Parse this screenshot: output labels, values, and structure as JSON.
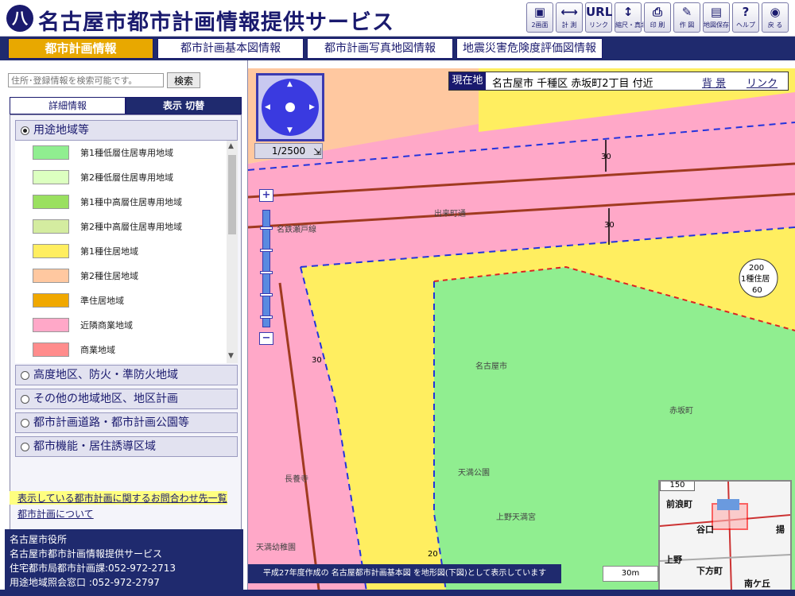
{
  "header": {
    "logo_glyph": "八",
    "title": "名古屋市都市計画情報提供サービス",
    "toolbar": [
      {
        "name": "two-screen-button",
        "icon_name": "two-screen-icon",
        "icon": "▣",
        "label": "2画面"
      },
      {
        "name": "measure-button",
        "icon_name": "ruler-icon",
        "icon": "⟷",
        "label": "計 測"
      },
      {
        "name": "link-button",
        "icon_name": "url-icon",
        "icon": "URL",
        "label": "リンク"
      },
      {
        "name": "zoom-button",
        "icon_name": "zoom-arrows-icon",
        "icon": "↕",
        "label": "縮尺・真北"
      },
      {
        "name": "print-button",
        "icon_name": "printer-icon",
        "icon": "⎙",
        "label": "印 刷"
      },
      {
        "name": "draw-button",
        "icon_name": "pencil-icon",
        "icon": "✎",
        "label": "作 図"
      },
      {
        "name": "save-map-button",
        "icon_name": "floppy-icon",
        "icon": "▤",
        "label": "地図保存"
      },
      {
        "name": "help-button",
        "icon_name": "question-icon",
        "icon": "?",
        "label": "ヘルプ"
      },
      {
        "name": "back-button",
        "icon_name": "back-icon",
        "icon": "◉",
        "label": "戻 る"
      }
    ]
  },
  "tabs": [
    {
      "label": "都市計画情報",
      "active": true
    },
    {
      "label": "都市計画基本図情報",
      "active": false
    },
    {
      "label": "都市計画写真地図情報",
      "active": false
    },
    {
      "label": "地震災害危険度評価図情報",
      "active": false
    }
  ],
  "sidebar": {
    "search_placeholder": "住所･登録情報を検索可能です。",
    "search_button": "検索",
    "mode_tabs": [
      {
        "label": "詳細情報"
      },
      {
        "label": "表示 切替"
      }
    ],
    "layers": [
      {
        "label": "用途地域等",
        "selected": true
      },
      {
        "label": "高度地区、防火・準防火地域",
        "selected": false
      },
      {
        "label": "その他の地域地区、地区計画",
        "selected": false
      },
      {
        "label": "都市計画道路・都市計画公園等",
        "selected": false
      },
      {
        "label": "都市機能・居住誘導区域",
        "selected": false
      }
    ],
    "legend": [
      {
        "label": "第1種低層住居専用地域",
        "color": "#90ee90"
      },
      {
        "label": "第2種低層住居専用地域",
        "color": "#dcffc0"
      },
      {
        "label": "第1種中高層住居専用地域",
        "color": "#9ae060"
      },
      {
        "label": "第2種中高層住居専用地域",
        "color": "#d4eca0"
      },
      {
        "label": "第1種住居地域",
        "color": "#ffee60"
      },
      {
        "label": "第2種住居地域",
        "color": "#ffc8a0"
      },
      {
        "label": "準住居地域",
        "color": "#f0a800"
      },
      {
        "label": "近隣商業地域",
        "color": "#ffa8c8"
      },
      {
        "label": "商業地域",
        "color": "#ff8c8c"
      }
    ],
    "links": [
      "表示している都市計画に関するお問合わせ先一覧",
      "都市計画について"
    ],
    "footer": [
      "名古屋市役所",
      "名古屋市都市計画情報提供サービス",
      "住宅都市局都市計画課:052-972-2713",
      "用途地域照会窓口 :052-972-2797"
    ]
  },
  "map": {
    "scale": "1/2500",
    "location_label": "現在地",
    "location_text": "名古屋市 千種区 赤坂町2丁目 付近",
    "background_link": "背 景",
    "link_link": "リンク",
    "credit": "平成27年度作成の 名古屋都市計画基本図 を地形図(下図)として表示しています",
    "scalebar": "30m",
    "labels": [
      {
        "text": "30",
        "name": "setback-label-30a"
      },
      {
        "text": "30",
        "name": "setback-label-30b"
      },
      {
        "text": "30",
        "name": "setback-label-30c"
      },
      {
        "text": "20",
        "name": "setback-label-20"
      },
      {
        "text": "出来町通",
        "name": "street-label-dekimachi"
      },
      {
        "text": "名鉄瀬戸線",
        "name": "railway-label"
      },
      {
        "text": "名古屋市",
        "name": "place-label-nagoya"
      },
      {
        "text": "赤坂町",
        "name": "place-label-akasaka"
      },
      {
        "text": "天満公園",
        "name": "place-label-tenma-park"
      },
      {
        "text": "上野天満宮",
        "name": "place-label-ueno-tenmangu"
      },
      {
        "text": "長養寺",
        "name": "place-label-chouyouji"
      },
      {
        "text": "天満幼稚園",
        "name": "place-label-kindergarten"
      }
    ],
    "zone_badge": [
      "200",
      "1種住居",
      "60"
    ],
    "overview": {
      "scale": "150",
      "labels": [
        "前浪町",
        "谷口",
        "上野",
        "下方町",
        "南ケ丘",
        "揚"
      ]
    }
  }
}
